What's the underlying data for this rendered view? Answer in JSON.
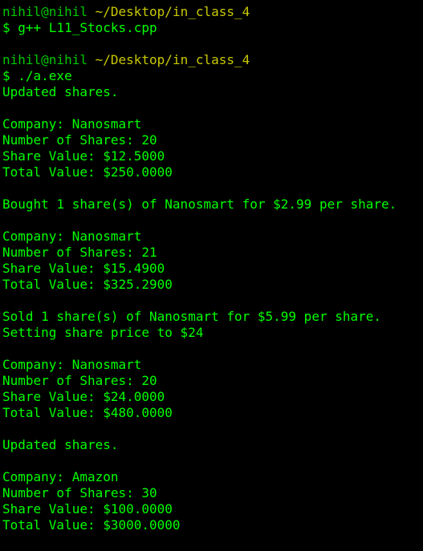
{
  "colors": {
    "background": "#000000",
    "output_text": "#00ff00",
    "prompt_user": "#00c800",
    "prompt_path": "#c8c800"
  },
  "session": [
    {
      "type": "prompt",
      "user": "nihil@nihil",
      "path": "~/Desktop/in_class_4"
    },
    {
      "type": "command",
      "text": "$ g++ L11_Stocks.cpp"
    },
    {
      "type": "blank"
    },
    {
      "type": "prompt",
      "user": "nihil@nihil",
      "path": "~/Desktop/in_class_4"
    },
    {
      "type": "command",
      "text": "$ ./a.exe"
    },
    {
      "type": "output",
      "text": "Updated shares."
    },
    {
      "type": "blank"
    },
    {
      "type": "output",
      "text": "Company: Nanosmart"
    },
    {
      "type": "output",
      "text": "Number of Shares: 20"
    },
    {
      "type": "output",
      "text": "Share Value: $12.5000"
    },
    {
      "type": "output",
      "text": "Total Value: $250.0000"
    },
    {
      "type": "blank"
    },
    {
      "type": "output",
      "text": "Bought 1 share(s) of Nanosmart for $2.99 per share."
    },
    {
      "type": "blank"
    },
    {
      "type": "output",
      "text": "Company: Nanosmart"
    },
    {
      "type": "output",
      "text": "Number of Shares: 21"
    },
    {
      "type": "output",
      "text": "Share Value: $15.4900"
    },
    {
      "type": "output",
      "text": "Total Value: $325.2900"
    },
    {
      "type": "blank"
    },
    {
      "type": "output",
      "text": "Sold 1 share(s) of Nanosmart for $5.99 per share."
    },
    {
      "type": "output",
      "text": "Setting share price to $24"
    },
    {
      "type": "blank"
    },
    {
      "type": "output",
      "text": "Company: Nanosmart"
    },
    {
      "type": "output",
      "text": "Number of Shares: 20"
    },
    {
      "type": "output",
      "text": "Share Value: $24.0000"
    },
    {
      "type": "output",
      "text": "Total Value: $480.0000"
    },
    {
      "type": "blank"
    },
    {
      "type": "output",
      "text": "Updated shares."
    },
    {
      "type": "blank"
    },
    {
      "type": "output",
      "text": "Company: Amazon"
    },
    {
      "type": "output",
      "text": "Number of Shares: 30"
    },
    {
      "type": "output",
      "text": "Share Value: $100.0000"
    },
    {
      "type": "output",
      "text": "Total Value: $3000.0000"
    }
  ]
}
